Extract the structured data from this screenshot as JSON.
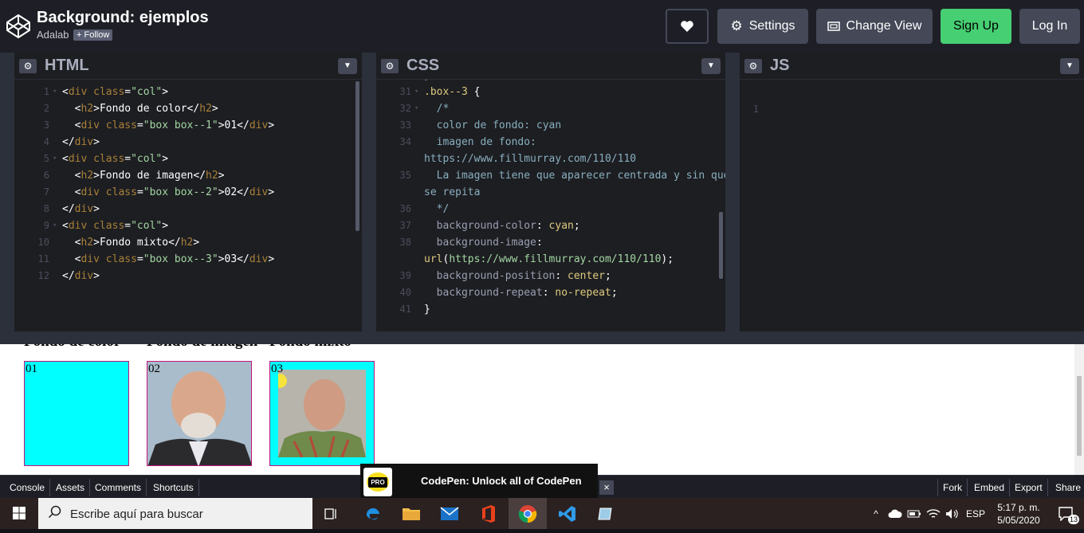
{
  "header": {
    "title": "Background: ejemplos",
    "author": "Adalab",
    "follow_label": "+ Follow",
    "settings_label": "Settings",
    "change_view_label": "Change View",
    "signup_label": "Sign Up",
    "login_label": "Log In"
  },
  "panes": {
    "html": {
      "name": "HTML"
    },
    "css": {
      "name": "CSS"
    },
    "js": {
      "name": "JS",
      "line1": "1"
    }
  },
  "html_code": [
    {
      "n": "1",
      "fold": true,
      "indent": "",
      "parts": [
        [
          "p",
          "<"
        ],
        [
          "t",
          "div"
        ],
        [
          "a",
          " class"
        ],
        [
          "p",
          "="
        ],
        [
          "s",
          "\"col\""
        ],
        [
          "p",
          ">"
        ]
      ]
    },
    {
      "n": "2",
      "fold": false,
      "indent": "  ",
      "parts": [
        [
          "p",
          "<"
        ],
        [
          "t",
          "h2"
        ],
        [
          "p",
          ">"
        ],
        [
          "x",
          "Fondo de color"
        ],
        [
          "p",
          "</"
        ],
        [
          "t",
          "h2"
        ],
        [
          "p",
          ">"
        ]
      ]
    },
    {
      "n": "3",
      "fold": false,
      "indent": "  ",
      "parts": [
        [
          "p",
          "<"
        ],
        [
          "t",
          "div"
        ],
        [
          "a",
          " class"
        ],
        [
          "p",
          "="
        ],
        [
          "s",
          "\"box box--1\""
        ],
        [
          "p",
          ">"
        ],
        [
          "x",
          "01"
        ],
        [
          "p",
          "</"
        ],
        [
          "t",
          "div"
        ],
        [
          "p",
          ">"
        ]
      ]
    },
    {
      "n": "4",
      "fold": false,
      "indent": "",
      "parts": [
        [
          "p",
          "</"
        ],
        [
          "t",
          "div"
        ],
        [
          "p",
          ">"
        ]
      ]
    },
    {
      "n": "5",
      "fold": true,
      "indent": "",
      "parts": [
        [
          "p",
          "<"
        ],
        [
          "t",
          "div"
        ],
        [
          "a",
          " class"
        ],
        [
          "p",
          "="
        ],
        [
          "s",
          "\"col\""
        ],
        [
          "p",
          ">"
        ]
      ]
    },
    {
      "n": "6",
      "fold": false,
      "indent": "  ",
      "parts": [
        [
          "p",
          "<"
        ],
        [
          "t",
          "h2"
        ],
        [
          "p",
          ">"
        ],
        [
          "x",
          "Fondo de imagen"
        ],
        [
          "p",
          "</"
        ],
        [
          "t",
          "h2"
        ],
        [
          "p",
          ">"
        ]
      ]
    },
    {
      "n": "7",
      "fold": false,
      "indent": "  ",
      "parts": [
        [
          "p",
          "<"
        ],
        [
          "t",
          "div"
        ],
        [
          "a",
          " class"
        ],
        [
          "p",
          "="
        ],
        [
          "s",
          "\"box box--2\""
        ],
        [
          "p",
          ">"
        ],
        [
          "x",
          "02"
        ],
        [
          "p",
          "</"
        ],
        [
          "t",
          "div"
        ],
        [
          "p",
          ">"
        ]
      ]
    },
    {
      "n": "8",
      "fold": false,
      "indent": "",
      "parts": [
        [
          "p",
          "</"
        ],
        [
          "t",
          "div"
        ],
        [
          "p",
          ">"
        ]
      ]
    },
    {
      "n": "9",
      "fold": true,
      "indent": "",
      "parts": [
        [
          "p",
          "<"
        ],
        [
          "t",
          "div"
        ],
        [
          "a",
          " class"
        ],
        [
          "p",
          "="
        ],
        [
          "s",
          "\"col\""
        ],
        [
          "p",
          ">"
        ]
      ]
    },
    {
      "n": "10",
      "fold": false,
      "indent": "  ",
      "parts": [
        [
          "p",
          "<"
        ],
        [
          "t",
          "h2"
        ],
        [
          "p",
          ">"
        ],
        [
          "x",
          "Fondo mixto"
        ],
        [
          "p",
          "</"
        ],
        [
          "t",
          "h2"
        ],
        [
          "p",
          ">"
        ]
      ]
    },
    {
      "n": "11",
      "fold": false,
      "indent": "  ",
      "parts": [
        [
          "p",
          "<"
        ],
        [
          "t",
          "div"
        ],
        [
          "a",
          " class"
        ],
        [
          "p",
          "="
        ],
        [
          "s",
          "\"box box--3\""
        ],
        [
          "p",
          ">"
        ],
        [
          "x",
          "03"
        ],
        [
          "p",
          "</"
        ],
        [
          "t",
          "div"
        ],
        [
          "p",
          ">"
        ]
      ]
    },
    {
      "n": "12",
      "fold": false,
      "indent": "",
      "parts": [
        [
          "p",
          "</"
        ],
        [
          "t",
          "div"
        ],
        [
          "p",
          ">"
        ]
      ]
    }
  ],
  "css_code": [
    {
      "n": "30",
      "fold": false,
      "parts": [
        [
          "p",
          "}"
        ]
      ]
    },
    {
      "n": "31",
      "fold": true,
      "parts": [
        [
          "sel",
          ".box--3"
        ],
        [
          "p",
          " {"
        ]
      ]
    },
    {
      "n": "32",
      "fold": true,
      "parts": [
        [
          "com",
          "  /*"
        ]
      ]
    },
    {
      "n": "33",
      "fold": false,
      "parts": [
        [
          "com",
          "  color de fondo: cyan"
        ]
      ]
    },
    {
      "n": "34",
      "fold": false,
      "parts": [
        [
          "com",
          "  imagen de fondo:"
        ]
      ]
    },
    {
      "n": "",
      "fold": false,
      "parts": [
        [
          "com",
          "https://www.fillmurray.com/110/110"
        ]
      ]
    },
    {
      "n": "35",
      "fold": false,
      "parts": [
        [
          "com",
          "  La imagen tiene que aparecer centrada y sin que"
        ]
      ]
    },
    {
      "n": "",
      "fold": false,
      "parts": [
        [
          "com",
          "se repita"
        ]
      ]
    },
    {
      "n": "36",
      "fold": false,
      "parts": [
        [
          "com",
          "  */"
        ]
      ]
    },
    {
      "n": "37",
      "fold": false,
      "parts": [
        [
          "prop",
          "  background-color"
        ],
        [
          "p",
          ": "
        ],
        [
          "val",
          "cyan"
        ],
        [
          "p",
          ";"
        ]
      ]
    },
    {
      "n": "38",
      "fold": false,
      "parts": [
        [
          "prop",
          "  background-image"
        ],
        [
          "p",
          ":"
        ]
      ]
    },
    {
      "n": "",
      "fold": false,
      "parts": [
        [
          "val",
          "url"
        ],
        [
          "p",
          "("
        ],
        [
          "url",
          "https://www.fillmurray.com/110/110"
        ],
        [
          "p",
          ");"
        ]
      ]
    },
    {
      "n": "39",
      "fold": false,
      "parts": [
        [
          "prop",
          "  background-position"
        ],
        [
          "p",
          ": "
        ],
        [
          "val",
          "center"
        ],
        [
          "p",
          ";"
        ]
      ]
    },
    {
      "n": "40",
      "fold": false,
      "parts": [
        [
          "prop",
          "  background-repeat"
        ],
        [
          "p",
          ": "
        ],
        [
          "val",
          "no-repeat"
        ],
        [
          "p",
          ";"
        ]
      ]
    },
    {
      "n": "41",
      "fold": false,
      "parts": [
        [
          "p",
          "}"
        ]
      ]
    }
  ],
  "preview": {
    "cols": [
      {
        "heading": "Fondo de color",
        "box_label": "01",
        "bg": "#00ffff"
      },
      {
        "heading": "Fondo de imagen",
        "box_label": "02",
        "bg": "#8a9aa8"
      },
      {
        "heading": "Fondo mixto",
        "box_label": "03",
        "bg": "#00ffff"
      }
    ]
  },
  "bottom": {
    "console": "Console",
    "assets": "Assets",
    "comments": "Comments",
    "shortcuts": "Shortcuts",
    "fork": "Fork",
    "embed": "Embed",
    "export": "Export",
    "share": "Share"
  },
  "promo": {
    "badge": "PRO",
    "text": "CodePen: Unlock all of CodePen",
    "close": "×"
  },
  "taskbar": {
    "search_placeholder": "Escribe aquí para buscar",
    "lang": "ESP",
    "time": "5:17 p. m.",
    "date": "5/05/2020",
    "notif_count": "13"
  },
  "colors": {
    "accent_green": "#47cf73",
    "box_border": "#c0157d",
    "cyan": "#00ffff"
  }
}
